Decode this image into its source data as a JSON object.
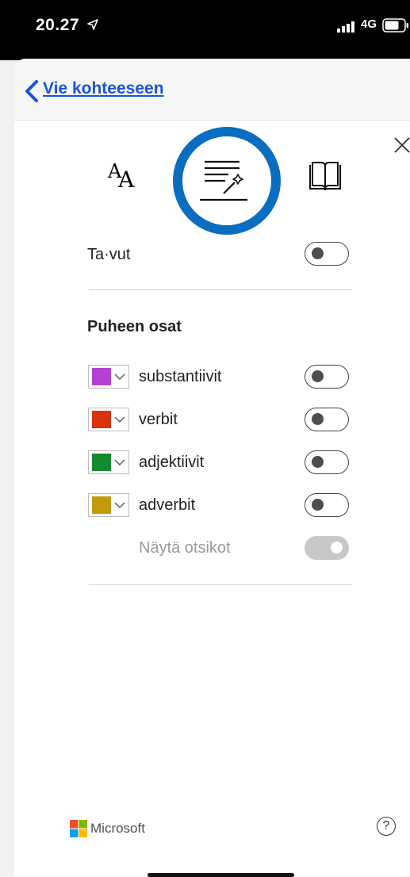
{
  "status_bar": {
    "time": "20.27",
    "network": "4G",
    "icons": [
      "location-arrow-icon",
      "signal-icon",
      "battery-icon"
    ]
  },
  "nav": {
    "back_label": "Vie kohteeseen",
    "back_icon": "chevron-left-icon"
  },
  "tabs": [
    {
      "icon": "text-size-icon",
      "glyph": "A"
    },
    {
      "icon": "grammar-tools-icon",
      "selected": true
    },
    {
      "icon": "book-icon"
    }
  ],
  "syllables": {
    "label": "Ta·vut",
    "on": false
  },
  "parts_of_speech": {
    "title": "Puheen osat",
    "items": [
      {
        "label": "substantiivit",
        "color": "#b540d6",
        "on": false
      },
      {
        "label": "verbit",
        "color": "#d9330d",
        "on": false
      },
      {
        "label": "adjektiivit",
        "color": "#138a2c",
        "on": false
      },
      {
        "label": "adverbit",
        "color": "#c19a0a",
        "on": false
      }
    ],
    "show_labels": {
      "label": "Näytä otsikot",
      "on": true,
      "disabled": true
    }
  },
  "footer": {
    "brand": "Microsoft",
    "help_glyph": "?",
    "logo_colors": [
      "#f25022",
      "#7fba00",
      "#00a4ef",
      "#ffb900"
    ]
  },
  "accent_color": "#0a6ec0",
  "link_color": "#1a55d6"
}
